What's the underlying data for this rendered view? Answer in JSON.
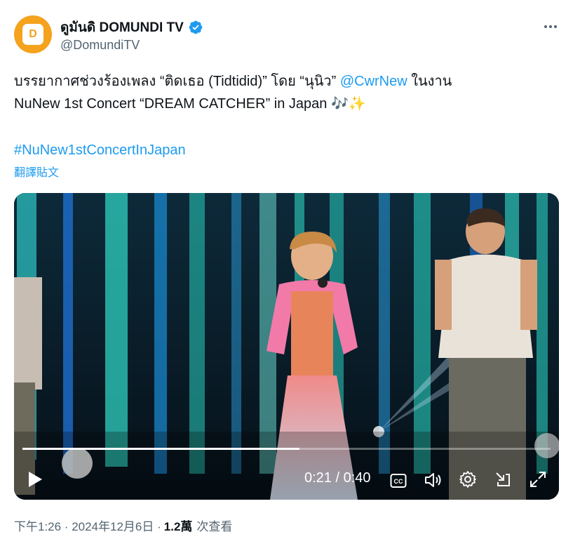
{
  "author": {
    "display_name": "ดูมันดิ DOMUNDI TV",
    "handle": "@DomundiTV",
    "avatar_letters": "D"
  },
  "tweet": {
    "line1_prefix": "บรรยากาศช่วงร้องเพลง “ติดเธอ (Tidtidid)” โดย “นุนิว” ",
    "mention": "@CwrNew",
    "line1_suffix": " ในงาน",
    "line2": "NuNew 1st Concert “DREAM CATCHER” in Japan 🎶✨",
    "hashtag": "#NuNew1stConcertInJapan",
    "translate_label": "翻譯貼文"
  },
  "video": {
    "current_time": "0:21",
    "duration": "0:40",
    "time_display": "0:21 / 0:40",
    "progress_fraction": 0.525
  },
  "footer": {
    "timestamp": "下午1:26 · 2024年12月6日 ·",
    "views_count": "1.2萬",
    "views_label": "次查看"
  },
  "colors": {
    "link": "#1d9bf0",
    "muted": "#536471",
    "avatar_bg": "#f5a21d"
  }
}
